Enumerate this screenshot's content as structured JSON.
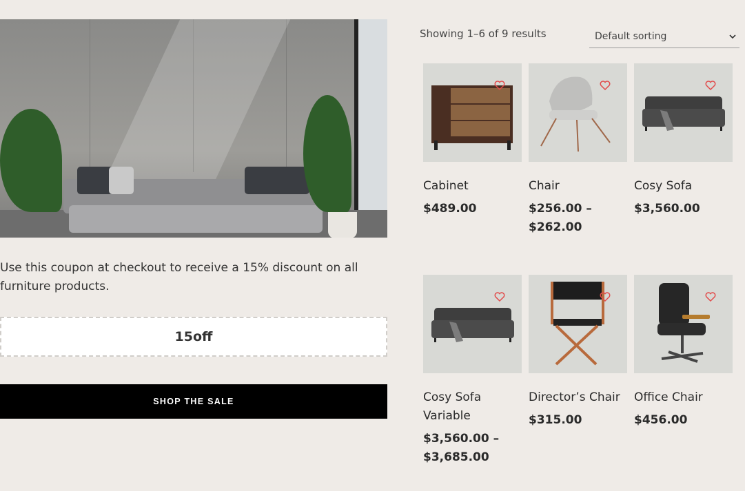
{
  "coupon": {
    "description": "Use this coupon at checkout to receive a 15% discount on all furniture products.",
    "code": "15off",
    "button_label": "SHOP THE SALE"
  },
  "shop": {
    "result_count": "Showing 1–6 of 9 results",
    "sorting": "Default sorting",
    "products": [
      {
        "name": "Cabinet",
        "price": "$489.00"
      },
      {
        "name": "Chair",
        "price": "$256.00 – $262.00"
      },
      {
        "name": "Cosy Sofa",
        "price": "$3,560.00"
      },
      {
        "name": "Cosy Sofa Variable",
        "price": "$3,560.00 – $3,685.00"
      },
      {
        "name": "Director’s Chair",
        "price": "$315.00"
      },
      {
        "name": "Office Chair",
        "price": "$456.00"
      }
    ]
  },
  "icons": {
    "wishlist": "heart-icon",
    "dropdown": "chevron-down-icon"
  },
  "colors": {
    "background": "#efebe7",
    "button": "#000000",
    "heart": "#e24b4b",
    "thumb_bg": "#d8d9d5"
  }
}
